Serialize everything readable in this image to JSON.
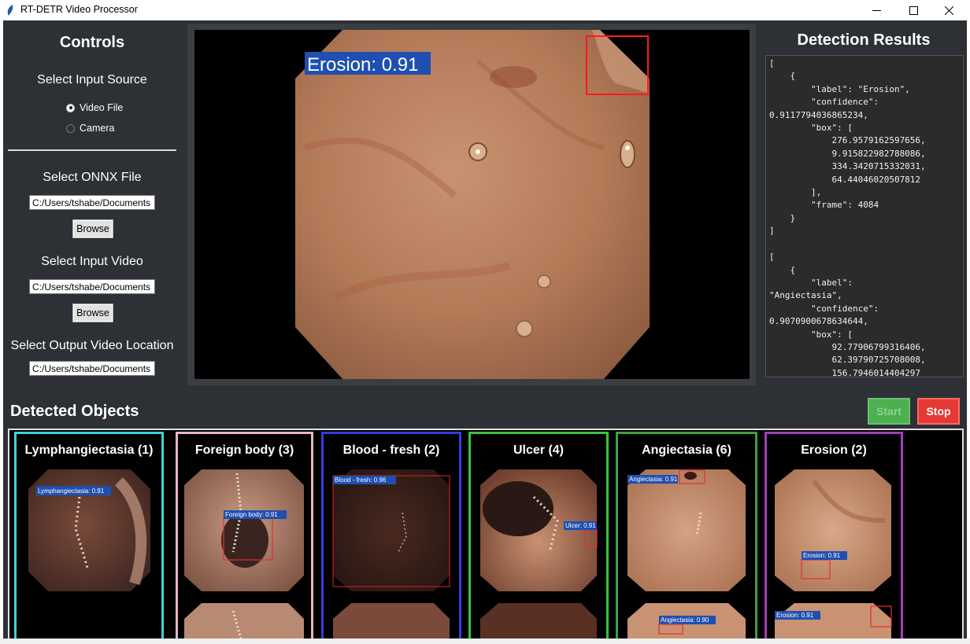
{
  "window": {
    "title": "RT-DETR Video Processor"
  },
  "controls": {
    "heading": "Controls",
    "input_source_label": "Select Input Source",
    "radio_options": [
      "Video File",
      "Camera"
    ],
    "selected_source": "Video File",
    "onnx_label": "Select ONNX File",
    "onnx_path": "C:/Users/tshabe/Documents",
    "browse_label": "Browse",
    "video_label": "Select Input Video",
    "video_path": "C:/Users/tshabe/Documents",
    "output_label": "Select Output Video Location",
    "output_path": "C:/Users/tshabe/Documents"
  },
  "video": {
    "overlay_label": "Erosion: 0.91"
  },
  "results": {
    "heading": "Detection Results",
    "json_text": "[\n    {\n        \"label\": \"Erosion\",\n        \"confidence\":\n0.9117794036865234,\n        \"box\": [\n            276.9579162597656,\n            9.915822982788086,\n            334.3420715332031,\n            64.44046020507812\n        ],\n        \"frame\": 4084\n    }\n]\n\n[\n    {\n        \"label\":\n\"Angiectasia\",\n        \"confidence\":\n0.9070900678634644,\n        \"box\": [\n            92.77906799316406,\n            62.39790725708008,\n            156.7946014404297"
  },
  "detected": {
    "heading": "Detected Objects",
    "start_label": "Start",
    "stop_label": "Stop",
    "colors": {
      "start": "#4caf50",
      "stop": "#e53935"
    },
    "cards": [
      {
        "title": "Lymphangiectasia (1)",
        "color": "#3fd1d6",
        "box_label": "Lymphangiectasia: 0.91",
        "bottom_label": ""
      },
      {
        "title": "Foreign body (3)",
        "color": "#e8b6c6",
        "box_label": "Foreign body: 0.91",
        "bottom_label": ""
      },
      {
        "title": "Blood - fresh (2)",
        "color": "#3a3ae0",
        "box_label": "Blood - fresh: 0.96",
        "bottom_label": ""
      },
      {
        "title": "Ulcer (4)",
        "color": "#3cc23c",
        "box_label": "Ulcer: 0.91",
        "bottom_label": ""
      },
      {
        "title": "Angiectasia (6)",
        "color": "#3aa33a",
        "box_label": "Angiectasia: 0.91",
        "bottom_label": "Angiectasia: 0.90"
      },
      {
        "title": "Erosion (2)",
        "color": "#a23fb8",
        "box_label": "Erosion: 0.91",
        "bottom_label": "Erosion: 0.91"
      }
    ]
  }
}
